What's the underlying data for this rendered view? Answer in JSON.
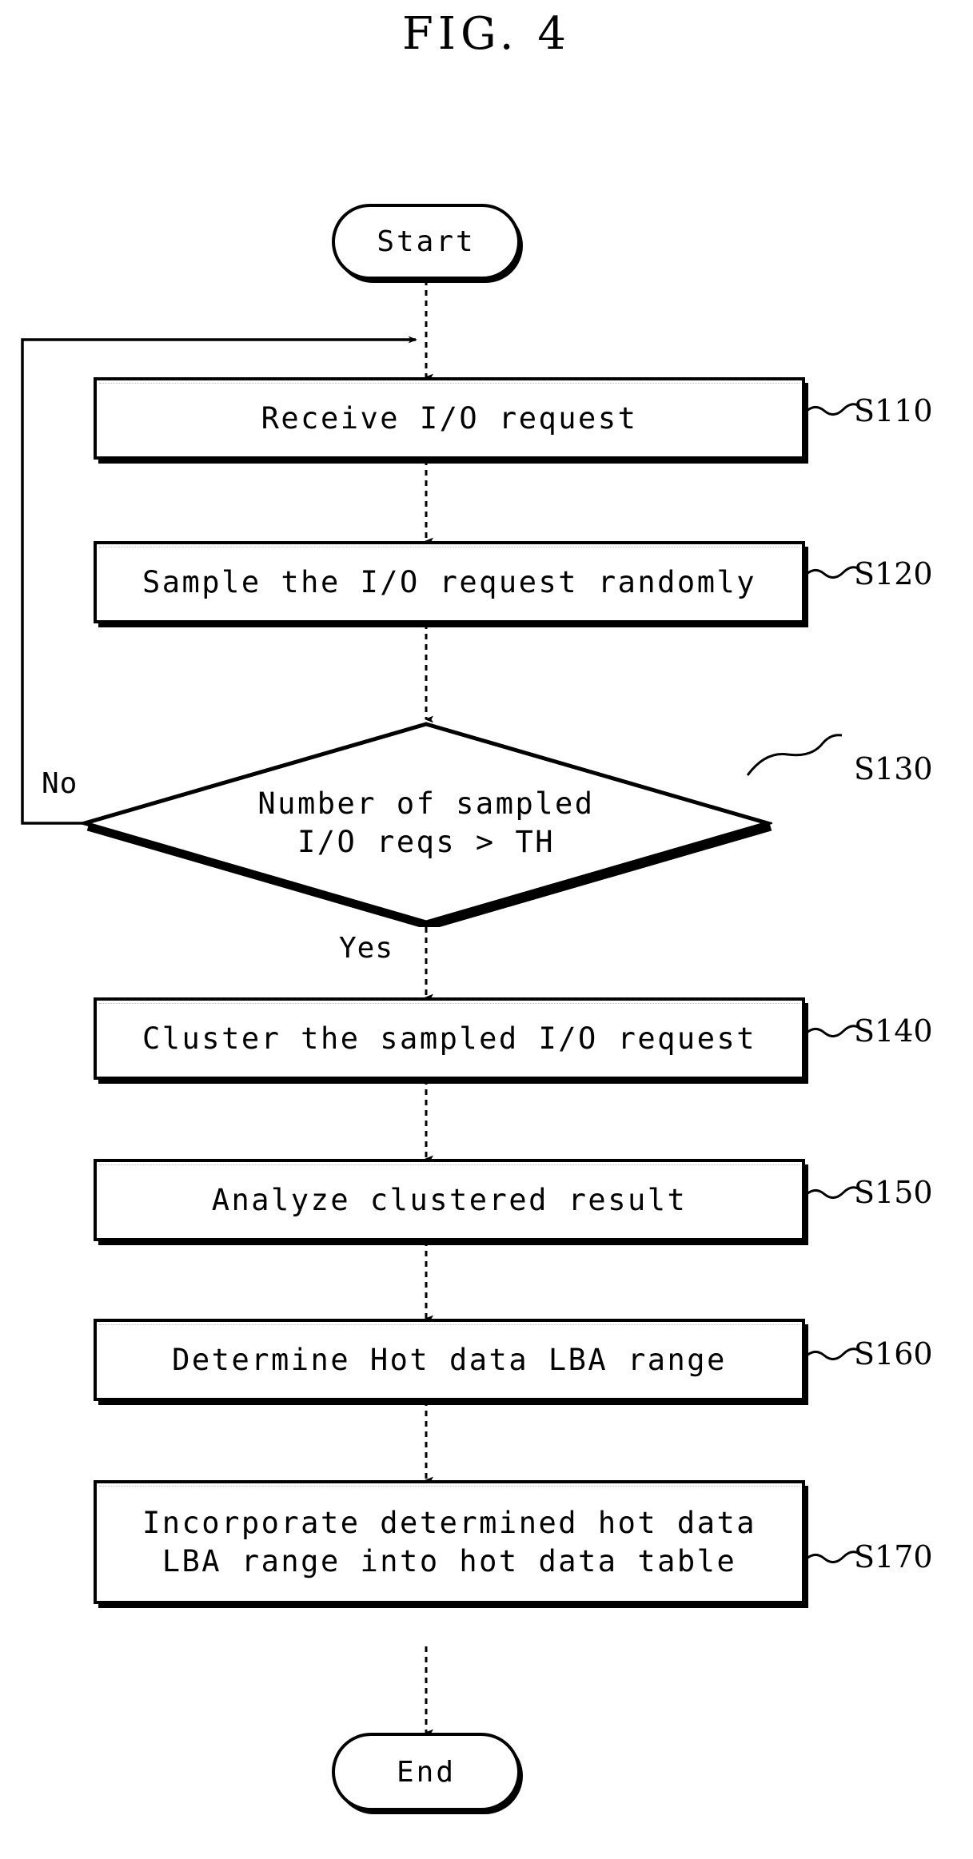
{
  "figure": {
    "title": "FIG. 4"
  },
  "nodes": {
    "start": {
      "label": "Start"
    },
    "s110": {
      "label": "Receive I/O request",
      "ref": "S110"
    },
    "s120": {
      "label": "Sample the I/O request randomly",
      "ref": "S120"
    },
    "s130": {
      "line1": "Number of sampled",
      "line2": "I/O reqs > TH",
      "ref": "S130"
    },
    "s140": {
      "label": "Cluster the sampled I/O request",
      "ref": "S140"
    },
    "s150": {
      "label": "Analyze clustered result",
      "ref": "S150"
    },
    "s160": {
      "label": "Determine Hot data LBA range",
      "ref": "S160"
    },
    "s170": {
      "line1": "Incorporate determined hot data",
      "line2": "LBA range into hot data table",
      "ref": "S170"
    },
    "end": {
      "label": "End"
    }
  },
  "branches": {
    "no": "No",
    "yes": "Yes"
  },
  "colors": {
    "stroke": "#000000",
    "fill": "#ffffff"
  },
  "chart_data": {
    "type": "diagram",
    "title": "FIG. 4",
    "diagram_kind": "flowchart",
    "orientation": "top-to-bottom",
    "nodes": [
      {
        "id": "start",
        "shape": "terminator",
        "text": "Start"
      },
      {
        "id": "S110",
        "shape": "process",
        "text": "Receive I/O request"
      },
      {
        "id": "S120",
        "shape": "process",
        "text": "Sample the I/O request randomly"
      },
      {
        "id": "S130",
        "shape": "decision",
        "text": "Number of sampled I/O reqs > TH"
      },
      {
        "id": "S140",
        "shape": "process",
        "text": "Cluster the sampled I/O request"
      },
      {
        "id": "S150",
        "shape": "process",
        "text": "Analyze clustered result"
      },
      {
        "id": "S160",
        "shape": "process",
        "text": "Determine Hot data LBA range"
      },
      {
        "id": "S170",
        "shape": "process",
        "text": "Incorporate determined hot data LBA range into hot data table"
      },
      {
        "id": "end",
        "shape": "terminator",
        "text": "End"
      }
    ],
    "edges": [
      {
        "from": "start",
        "to": "S110",
        "label": ""
      },
      {
        "from": "S110",
        "to": "S120",
        "label": ""
      },
      {
        "from": "S120",
        "to": "S130",
        "label": ""
      },
      {
        "from": "S130",
        "to": "S140",
        "label": "Yes"
      },
      {
        "from": "S130",
        "to": "S110",
        "label": "No"
      },
      {
        "from": "S140",
        "to": "S150",
        "label": ""
      },
      {
        "from": "S150",
        "to": "S160",
        "label": ""
      },
      {
        "from": "S160",
        "to": "S170",
        "label": ""
      },
      {
        "from": "S170",
        "to": "end",
        "label": ""
      }
    ]
  }
}
